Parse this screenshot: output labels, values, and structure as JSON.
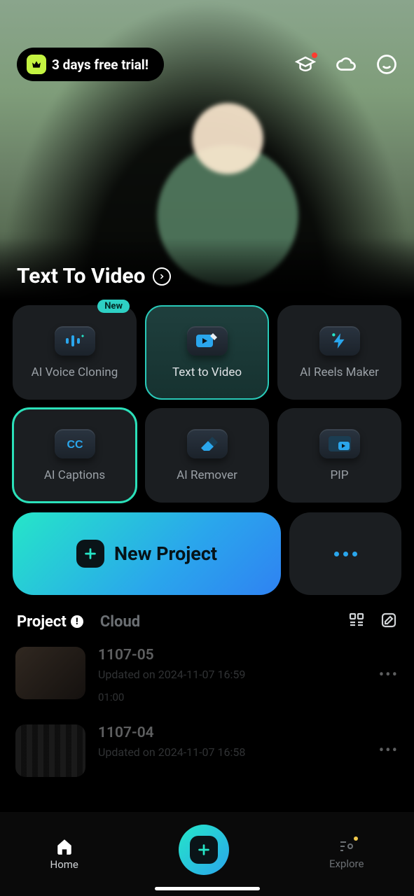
{
  "topbar": {
    "trial_label": "3 days free trial!"
  },
  "hero": {
    "title": "Text To Video"
  },
  "features": [
    {
      "label": "AI Voice Cloning",
      "badge": "New"
    },
    {
      "label": "Text  to Video"
    },
    {
      "label": "AI Reels Maker"
    },
    {
      "label": "AI Captions"
    },
    {
      "label": "AI Remover"
    },
    {
      "label": "PIP"
    }
  ],
  "actions": {
    "new_project": "New Project"
  },
  "project_tabs": {
    "project": "Project",
    "cloud": "Cloud"
  },
  "projects": [
    {
      "name": "1107-05",
      "updated": "Updated on 2024-11-07 16:59",
      "duration": "01:00"
    },
    {
      "name": "1107-04",
      "updated": "Updated on 2024-11-07 16:58",
      "duration": ""
    }
  ],
  "nav": {
    "home": "Home",
    "explore": "Explore"
  }
}
